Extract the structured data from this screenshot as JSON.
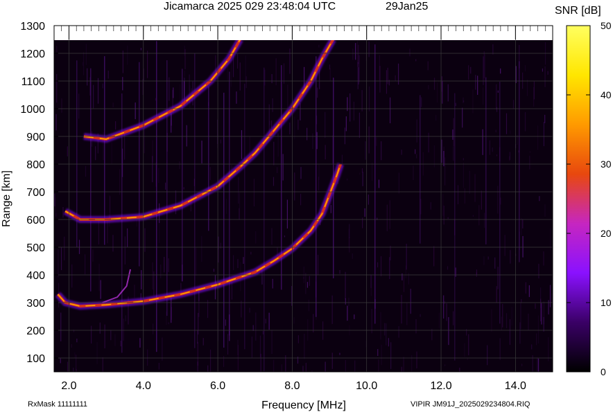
{
  "header": {
    "title": "Jicamarca 2025 029 23:48:04 UTC",
    "date": "29Jan25"
  },
  "footer": {
    "rx_mask": "RxMask 11111111",
    "file": "VIPIR  JM91J_2025029234804.RIQ"
  },
  "colorbar": {
    "label": "SNR [dB]",
    "min": 0,
    "max": 50,
    "ticks": [
      "0",
      "10",
      "20",
      "30",
      "40",
      "50"
    ],
    "stops": [
      "#000000",
      "#3a0066",
      "#8a11ff",
      "#c626c0",
      "#e8480e",
      "#ff9a00",
      "#ffe600",
      "#ffff60"
    ]
  },
  "chart_data": {
    "type": "heatmap",
    "title": "Jicamarca 2025 029 23:48:04 UTC",
    "xlabel": "Frequency [MHz]",
    "ylabel": "Range [km]",
    "xlim": [
      1.6,
      15.0
    ],
    "ylim": [
      50,
      1300
    ],
    "x_ticks": [
      "2.0",
      "4.0",
      "6.0",
      "8.0",
      "10.0",
      "12.0",
      "14.0"
    ],
    "y_ticks": [
      "100",
      "200",
      "300",
      "400",
      "500",
      "600",
      "700",
      "800",
      "900",
      "1000",
      "1100",
      "1200",
      "1300"
    ],
    "grid": true,
    "echo_traces": [
      {
        "name": "",
        "points": [
          [
            1.7,
            330
          ],
          [
            1.9,
            300
          ],
          [
            2.3,
            287
          ],
          [
            3.0,
            292
          ],
          [
            4.0,
            305
          ],
          [
            5.0,
            330
          ],
          [
            6.0,
            365
          ],
          [
            7.0,
            410
          ],
          [
            7.5,
            450
          ],
          [
            8.0,
            495
          ],
          [
            8.5,
            560
          ],
          [
            8.8,
            620
          ],
          [
            9.0,
            690
          ],
          [
            9.2,
            760
          ],
          [
            9.3,
            800
          ]
        ]
      },
      {
        "name": "",
        "points": [
          [
            1.9,
            630
          ],
          [
            2.3,
            600
          ],
          [
            3.0,
            600
          ],
          [
            4.0,
            610
          ],
          [
            5.0,
            650
          ],
          [
            6.0,
            720
          ],
          [
            6.6,
            790
          ],
          [
            7.0,
            840
          ],
          [
            7.5,
            920
          ],
          [
            8.0,
            1000
          ],
          [
            8.5,
            1100
          ],
          [
            8.8,
            1180
          ],
          [
            9.1,
            1250
          ]
        ]
      },
      {
        "name": "",
        "points": [
          [
            2.4,
            900
          ],
          [
            3.0,
            890
          ],
          [
            4.0,
            940
          ],
          [
            5.0,
            1010
          ],
          [
            5.8,
            1100
          ],
          [
            6.3,
            1180
          ],
          [
            6.6,
            1250
          ]
        ]
      }
    ]
  }
}
